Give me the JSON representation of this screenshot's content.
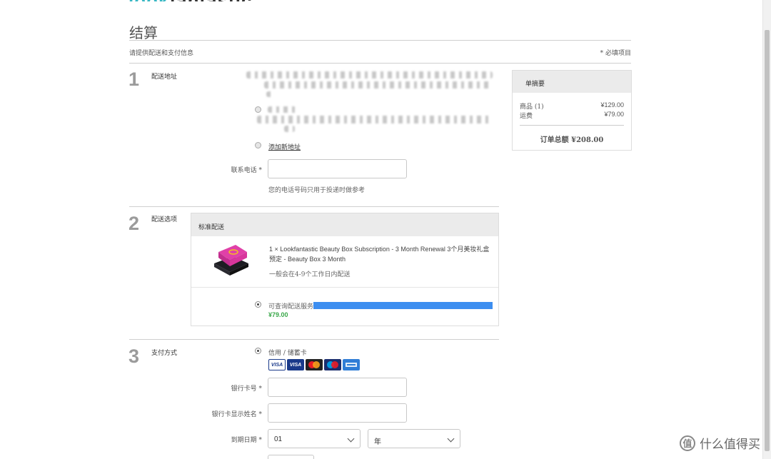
{
  "page": {
    "title": "结算",
    "subtitle": "请提供配送和支付信息",
    "required_note": "* 必填项目"
  },
  "steps": [
    {
      "number": "1",
      "label": "配送地址"
    },
    {
      "number": "2",
      "label": "配送选项"
    },
    {
      "number": "3",
      "label": "支付方式"
    }
  ],
  "address": {
    "add_new_link": "添加新地址",
    "phone_label": "联系电话 *",
    "phone_value": "",
    "phone_hint": "您的电话号码只用于投递时做参考"
  },
  "summary": {
    "header": "单摘要",
    "rows": [
      {
        "label": "商品 (1)",
        "value": "¥129.00"
      },
      {
        "label": "运费",
        "value": "¥79.00"
      }
    ],
    "total": "订单总额 ¥208.00"
  },
  "shipping": {
    "header": "标准配送",
    "product_line1": "1 × Lookfantastic Beauty Box Subscription - 3 Month Renewal 3个月美妆礼盒",
    "product_line2": "预定 - Beauty Box 3 Month",
    "eta": "一般会在4-9个工作日内配送",
    "service_label": "可查询配送服务",
    "price": "¥79.00"
  },
  "payment": {
    "method_label": "信用 / 储蓄卡",
    "card_icons": [
      "visa-icon",
      "visa-electron-icon",
      "mastercard-icon",
      "maestro-icon",
      "amex-icon"
    ],
    "card_labels": [
      "VISA",
      "VISA"
    ],
    "card_number_label": "银行卡号 *",
    "card_name_label": "银行卡显示姓名 *",
    "expiry_label": "到期日期 *",
    "expiry_month": "01",
    "expiry_year": "年"
  },
  "watermark": {
    "text": "什么值得买",
    "mark": "值"
  },
  "colors": {
    "step_number": "#9b9b9b",
    "price_green": "#3aa84a",
    "highlight_blue": "#3d8ef0",
    "panel_grey": "#ebebeb"
  }
}
